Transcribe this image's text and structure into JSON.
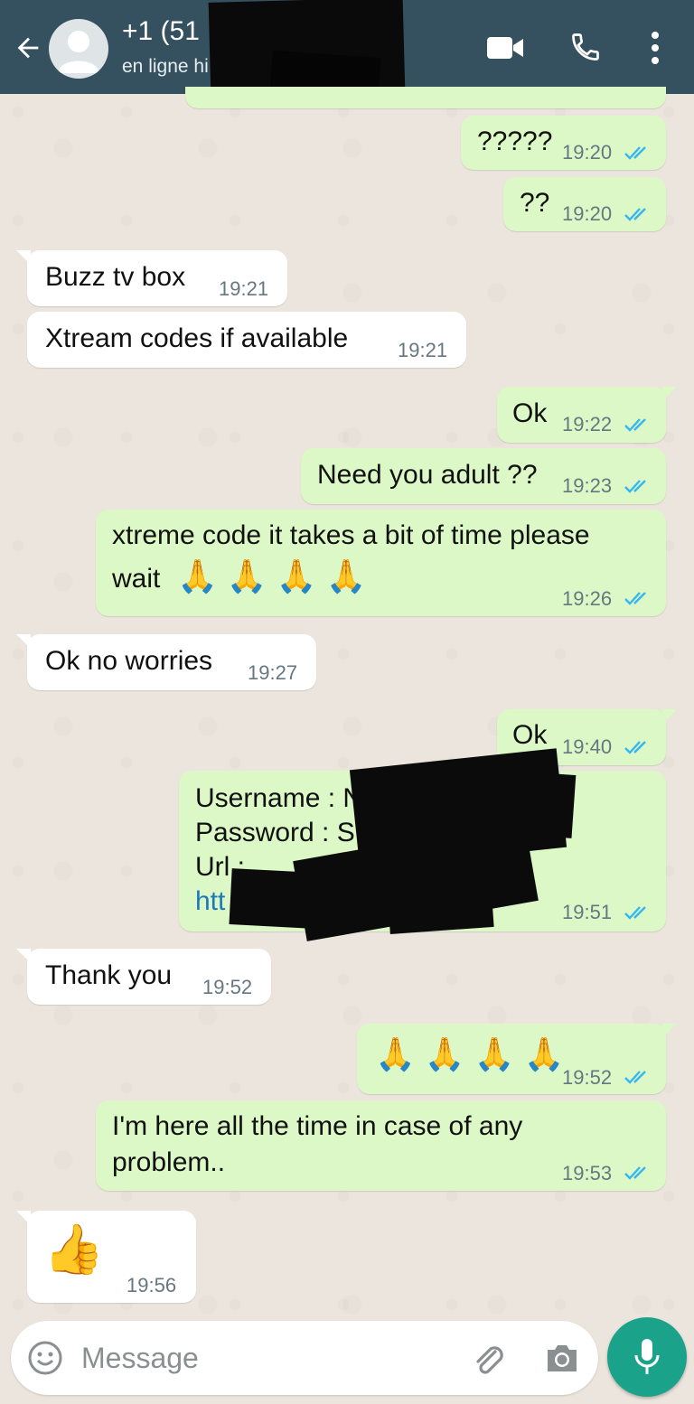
{
  "header": {
    "name": "+1 (51",
    "status": "en ligne hi",
    "icons": [
      "back-arrow-icon",
      "avatar",
      "video-call-icon",
      "phone-icon",
      "more-vert-icon"
    ]
  },
  "messages": [
    {
      "dir": "out",
      "text": "?????",
      "time": "19:20",
      "read": true
    },
    {
      "dir": "out",
      "text": "??",
      "time": "19:20",
      "read": true
    },
    {
      "dir": "in",
      "text": "Buzz tv box",
      "time": "19:21"
    },
    {
      "dir": "in",
      "text": "Xtream codes if available",
      "time": "19:21"
    },
    {
      "dir": "out",
      "text": "Ok",
      "time": "19:22",
      "read": true
    },
    {
      "dir": "out",
      "text": "Need you adult ??",
      "time": "19:23",
      "read": true
    },
    {
      "dir": "out",
      "line1": "xtreme code it takes a bit of time please",
      "line2": "wait",
      "emoji": "🙏 🙏 🙏 🙏",
      "time": "19:26",
      "read": true
    },
    {
      "dir": "in",
      "text": "Ok no worries",
      "time": "19:27"
    },
    {
      "dir": "out",
      "text": "Ok",
      "time": "19:40",
      "read": true
    },
    {
      "dir": "out",
      "line1": "Username : N",
      "line2": " Password : S",
      "line3": " Url       :",
      "link": "htt",
      "time": "19:51",
      "read": true
    },
    {
      "dir": "in",
      "text": "Thank you",
      "time": "19:52"
    },
    {
      "dir": "out",
      "emoji": "🙏 🙏 🙏 🙏",
      "time": "19:52",
      "read": true
    },
    {
      "dir": "out",
      "line1": "I'm here all the time in case of any",
      "line2": "problem..",
      "time": "19:53",
      "read": true
    },
    {
      "dir": "in",
      "emoji": "👍",
      "time": "19:56"
    }
  ],
  "input": {
    "placeholder": "Message"
  },
  "colors": {
    "header_bg": "#35505f",
    "outgoing_bubble": "#dcf8c6",
    "incoming_bubble": "#ffffff",
    "read_ticks": "#34b7f1",
    "mic_button": "#1aa38a",
    "chat_bg": "#ece5dd"
  }
}
